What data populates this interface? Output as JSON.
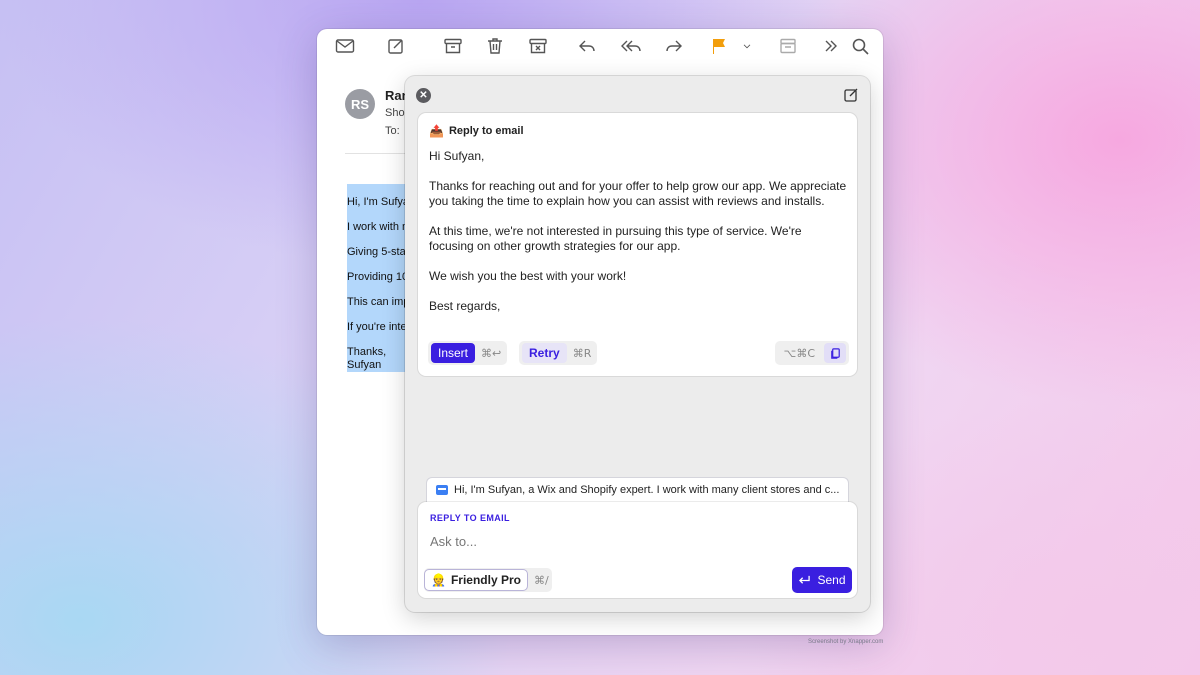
{
  "toolbar": {
    "icons": [
      "envelope-icon",
      "compose-icon",
      "archive-icon",
      "trash-icon",
      "junk-icon",
      "reply-icon",
      "reply-all-icon",
      "forward-icon",
      "flag-icon",
      "chevron-down-icon",
      "move-icon",
      "more-icon",
      "search-icon"
    ],
    "flag_color": "#f29e0c"
  },
  "message": {
    "avatar_initials": "RS",
    "sender": "Ran",
    "subject": "Sho",
    "to_label": "To:",
    "body_lines": [
      "Hi, I'm Sufyan",
      "I work with m",
      "Giving 5-sta",
      "Providing 10",
      "This can imp",
      "If you're inte"
    ],
    "sign_off": "Thanks,",
    "signature": "Sufyan"
  },
  "assistant": {
    "card_title": "Reply to email",
    "card_emoji": "📤",
    "reply": {
      "greeting": "Hi Sufyan,",
      "p1": "Thanks for reaching out and for your offer to help grow our app. We appreciate you taking the time to explain how you can assist with reviews and installs.",
      "p2": "At this time, we're not interested in pursuing this type of service. We're focusing on other growth strategies for our app.",
      "p3": "We wish you the best with your work!",
      "closing": "Best regards,"
    },
    "insert_label": "Insert",
    "insert_shortcut": "⌘↩",
    "retry_label": "Retry",
    "retry_shortcut": "⌘R",
    "copy_shortcut": "⌥⌘C",
    "context_snippet": "Hi, I'm Sufyan, a Wix and Shopify expert.  I work with many client stores and c...",
    "mode_label": "REPLY TO EMAIL",
    "input_placeholder": "Ask to...",
    "persona_emoji": "👷",
    "persona_label": "Friendly Pro",
    "persona_shortcut": "⌘/",
    "send_label": "Send",
    "accent_color": "#3a1fe0"
  },
  "watermark": "Screenshot by Xnapper.com"
}
